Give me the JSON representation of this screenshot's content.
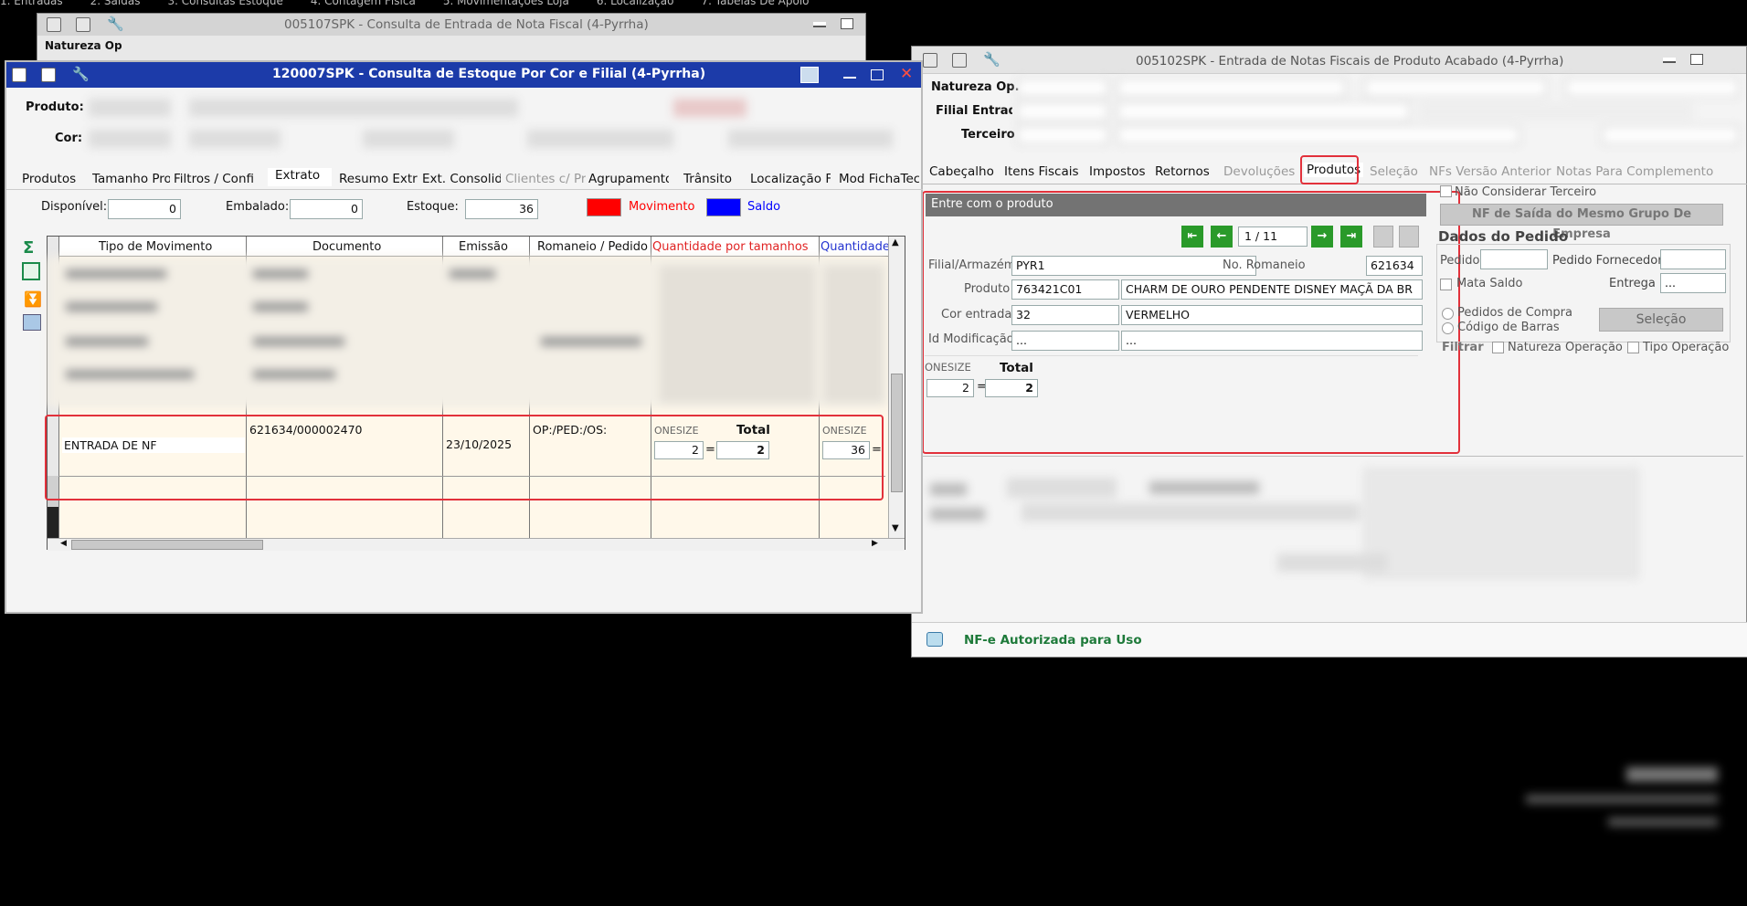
{
  "top_menu": [
    "1. Entradas",
    "2. Saídas",
    "3. Consultas Estoque",
    "4. Contagem Física",
    "5. Movimentações Loja",
    "6. Localização",
    "7. Tabelas De Apoio"
  ],
  "back_window": {
    "title": "005107SPK - Consulta de Entrada de Nota Fiscal (4-Pyrrha)",
    "row_label": "Natureza Op"
  },
  "stock_window": {
    "title": "120007SPK - Consulta de Estoque Por Cor e Filial (4-Pyrrha)",
    "produto_label": "Produto:",
    "cor_label": "Cor:",
    "tabs": [
      {
        "label": "Produtos",
        "disabled": false
      },
      {
        "label": "Tamanho Prod",
        "disabled": false
      },
      {
        "label": "Filtros / Config",
        "disabled": false
      },
      {
        "label": "Extrato",
        "disabled": false
      },
      {
        "label": "Resumo Extrato",
        "disabled": false
      },
      {
        "label": "Ext. Consolidado",
        "disabled": false
      },
      {
        "label": "Clientes c/ Prod",
        "disabled": true
      },
      {
        "label": "Agrupamentos",
        "disabled": false
      },
      {
        "label": "Trânsito",
        "disabled": false
      },
      {
        "label": "Localização Fis",
        "disabled": false
      },
      {
        "label": "Mod FichaTec",
        "disabled": false
      }
    ],
    "disponivel_label": "Disponível:",
    "disponivel_value": "0",
    "embalado_label": "Embalado:",
    "embalado_value": "0",
    "estoque_label": "Estoque:",
    "estoque_value": "36",
    "legend_movimento": "Movimento",
    "legend_saldo": "Saldo",
    "legend_movimento_color": "#ff0000",
    "legend_saldo_color": "#0000ff",
    "columns": [
      "Tipo de Movimento",
      "Documento",
      "Emissão",
      "Romaneio / Pedido",
      "Quantidade por tamanhos",
      "Quantidade"
    ],
    "highlight_row": {
      "tipo": "ENTRADA DE NF",
      "documento": "621634/000002470",
      "emissao": "23/10/2025",
      "romaneio": "OP:/PED:/OS:",
      "size_label": "ONESIZE",
      "total_label": "Total",
      "qty_size": "2",
      "qty_total": "2",
      "saldo_size_label": "ONESIZE",
      "saldo_value": "36",
      "eq": "="
    }
  },
  "nf_window": {
    "title": "005102SPK - Entrada de Notas Fiscais de Produto Acabado (4-Pyrrha)",
    "natureza_label": "Natureza Op.",
    "filial_label": "Filial Entrada",
    "terceiro_label": "Terceiro",
    "tabs": [
      {
        "label": "Cabeçalho",
        "disabled": false
      },
      {
        "label": "Itens Fiscais",
        "disabled": false
      },
      {
        "label": "Impostos",
        "disabled": false
      },
      {
        "label": "Retornos",
        "disabled": false
      },
      {
        "label": "Devoluções",
        "disabled": true
      },
      {
        "label": "Produtos",
        "disabled": false
      },
      {
        "label": "Seleção",
        "disabled": true
      },
      {
        "label": "NFs Versão Anterior",
        "disabled": true
      },
      {
        "label": "Notas Para Complemento",
        "disabled": true
      }
    ],
    "panel_title": "Entre com o produto",
    "nav_counter": "1 / 11",
    "filial_armazem_label": "Filial/Armazém",
    "filial_armazem_value": "PYR1",
    "romaneio_label": "No. Romaneio",
    "romaneio_value": "621634",
    "produto_label": "Produto",
    "produto_code": "763421C01",
    "produto_desc": "CHARM DE OURO PENDENTE DISNEY MAÇÃ DA BR",
    "cor_label": "Cor entrada",
    "cor_code": "32",
    "cor_desc": "VERMELHO",
    "idmod_label": "Id Modificação",
    "idmod_value": "...",
    "idmod_desc": "...",
    "size_label": "ONESIZE",
    "total_label": "Total",
    "size_qty": "2",
    "total_qty": "2",
    "eq": "=",
    "nao_considerar": "Não Considerar Terceiro",
    "nf_saida_btn": "NF de Saída do Mesmo Grupo De Empresa",
    "dados_pedido": "Dados do Pedido",
    "pedido_label": "Pedido",
    "pedido_fornecedor_label": "Pedido Fornecedor",
    "mata_saldo": "Mata Saldo",
    "entrega_label": "Entrega",
    "entrega_value": "...",
    "pedidos_compra": "Pedidos de Compra",
    "codigo_barras": "Código de Barras",
    "selecao_btn": "Seleção",
    "filtrar_label": "Filtrar",
    "natureza_operacao": "Natureza Operação",
    "tipo_operacao": "Tipo Operação",
    "status_text": "NF-e Autorizada para Uso"
  }
}
